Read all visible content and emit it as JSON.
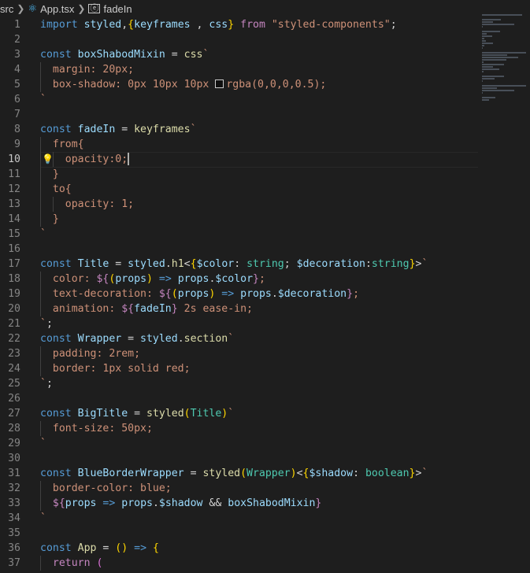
{
  "breadcrumb": {
    "folder": "src",
    "file": "App.tsx",
    "symbol": "fadeIn"
  },
  "editor": {
    "current_line": 10,
    "lines": [
      {
        "n": "1",
        "parts": [
          [
            "kw",
            "import "
          ],
          [
            "v",
            "styled"
          ],
          [
            "",
            ","
          ],
          [
            "br1",
            "{"
          ],
          [
            "v",
            "keyframes"
          ],
          [
            "",
            " ,"
          ],
          [
            "v",
            " css"
          ],
          [
            "br1",
            "}"
          ],
          [
            "ctl",
            " from "
          ],
          [
            "str",
            "\"styled-components\""
          ],
          [
            "",
            ";"
          ]
        ]
      },
      {
        "n": "2",
        "parts": []
      },
      {
        "n": "3",
        "parts": [
          [
            "kw",
            "const "
          ],
          [
            "v",
            "boxShabodMixin"
          ],
          [
            "",
            " = "
          ],
          [
            "fn",
            "css"
          ],
          [
            "str",
            "`"
          ]
        ]
      },
      {
        "n": "4",
        "indent": 1,
        "parts": [
          [
            "str",
            "  margin: 20px;"
          ]
        ]
      },
      {
        "n": "5",
        "indent": 1,
        "parts": [
          [
            "str",
            "  box-shadow: 0px 10px 10px "
          ],
          [
            "swatch",
            ""
          ],
          [
            "str",
            "rgba(0,0,0,0.5);"
          ]
        ]
      },
      {
        "n": "6",
        "parts": [
          [
            "str",
            "`"
          ]
        ]
      },
      {
        "n": "7",
        "parts": []
      },
      {
        "n": "8",
        "parts": [
          [
            "kw",
            "const "
          ],
          [
            "v",
            "fadeIn"
          ],
          [
            "",
            " = "
          ],
          [
            "fn",
            "keyframes"
          ],
          [
            "str",
            "`"
          ]
        ]
      },
      {
        "n": "9",
        "indent": 1,
        "parts": [
          [
            "str",
            "  from{"
          ]
        ]
      },
      {
        "n": "10",
        "indent": 2,
        "bulb": true,
        "cursor": true,
        "parts": [
          [
            "str",
            "    opacity:0;"
          ]
        ]
      },
      {
        "n": "11",
        "indent": 1,
        "parts": [
          [
            "str",
            "  }"
          ]
        ]
      },
      {
        "n": "12",
        "indent": 1,
        "parts": [
          [
            "str",
            "  to{"
          ]
        ]
      },
      {
        "n": "13",
        "indent": 2,
        "parts": [
          [
            "str",
            "    opacity: 1;"
          ]
        ]
      },
      {
        "n": "14",
        "indent": 1,
        "parts": [
          [
            "str",
            "  }"
          ]
        ]
      },
      {
        "n": "15",
        "parts": [
          [
            "str",
            "`"
          ]
        ]
      },
      {
        "n": "16",
        "parts": []
      },
      {
        "n": "17",
        "parts": [
          [
            "kw",
            "const "
          ],
          [
            "v",
            "Title"
          ],
          [
            "",
            " = "
          ],
          [
            "v",
            "styled"
          ],
          [
            "",
            "."
          ],
          [
            "fn",
            "h1"
          ],
          [
            "",
            "<"
          ],
          [
            "br1",
            "{"
          ],
          [
            "v",
            "$color"
          ],
          [
            "",
            ": "
          ],
          [
            "ty",
            "string"
          ],
          [
            "",
            "; "
          ],
          [
            "v",
            "$decoration"
          ],
          [
            "",
            ":"
          ],
          [
            "ty",
            "string"
          ],
          [
            "br1",
            "}"
          ],
          [
            "",
            ">"
          ],
          [
            "str",
            "`"
          ]
        ]
      },
      {
        "n": "18",
        "indent": 1,
        "parts": [
          [
            "str",
            "  color: "
          ],
          [
            "ctl",
            "${"
          ],
          [
            "br1",
            "("
          ],
          [
            "v",
            "props"
          ],
          [
            "br1",
            ")"
          ],
          [
            "kw",
            " =>"
          ],
          [
            "v",
            " props"
          ],
          [
            "",
            "."
          ],
          [
            "v",
            "$color"
          ],
          [
            "ctl",
            "}"
          ],
          [
            "str",
            ";"
          ]
        ]
      },
      {
        "n": "19",
        "indent": 1,
        "parts": [
          [
            "str",
            "  text-decoration: "
          ],
          [
            "ctl",
            "${"
          ],
          [
            "br1",
            "("
          ],
          [
            "v",
            "props"
          ],
          [
            "br1",
            ")"
          ],
          [
            "kw",
            " =>"
          ],
          [
            "v",
            " props"
          ],
          [
            "",
            "."
          ],
          [
            "v",
            "$decoration"
          ],
          [
            "ctl",
            "}"
          ],
          [
            "str",
            ";"
          ]
        ]
      },
      {
        "n": "20",
        "indent": 1,
        "parts": [
          [
            "str",
            "  animation: "
          ],
          [
            "ctl",
            "${"
          ],
          [
            "v",
            "fadeIn"
          ],
          [
            "ctl",
            "}"
          ],
          [
            "str",
            " 2s ease-in;"
          ]
        ]
      },
      {
        "n": "21",
        "parts": [
          [
            "str",
            "`"
          ],
          [
            "",
            ";"
          ]
        ]
      },
      {
        "n": "22",
        "parts": [
          [
            "kw",
            "const "
          ],
          [
            "v",
            "Wrapper"
          ],
          [
            "",
            " = "
          ],
          [
            "v",
            "styled"
          ],
          [
            "",
            "."
          ],
          [
            "fn",
            "section"
          ],
          [
            "str",
            "`"
          ]
        ]
      },
      {
        "n": "23",
        "indent": 1,
        "parts": [
          [
            "str",
            "  padding: 2rem;"
          ]
        ]
      },
      {
        "n": "24",
        "indent": 1,
        "parts": [
          [
            "str",
            "  border: 1px solid red;"
          ]
        ]
      },
      {
        "n": "25",
        "parts": [
          [
            "str",
            "`"
          ],
          [
            "",
            ";"
          ]
        ]
      },
      {
        "n": "26",
        "parts": []
      },
      {
        "n": "27",
        "parts": [
          [
            "kw",
            "const "
          ],
          [
            "v",
            "BigTitle"
          ],
          [
            "",
            " = "
          ],
          [
            "fn",
            "styled"
          ],
          [
            "br1",
            "("
          ],
          [
            "ty",
            "Title"
          ],
          [
            "br1",
            ")"
          ],
          [
            "str",
            "`"
          ]
        ]
      },
      {
        "n": "28",
        "indent": 1,
        "parts": [
          [
            "str",
            "  font-size: 50px;"
          ]
        ]
      },
      {
        "n": "29",
        "parts": [
          [
            "str",
            "`"
          ]
        ]
      },
      {
        "n": "30",
        "parts": []
      },
      {
        "n": "31",
        "parts": [
          [
            "kw",
            "const "
          ],
          [
            "v",
            "BlueBorderWrapper"
          ],
          [
            "",
            " = "
          ],
          [
            "fn",
            "styled"
          ],
          [
            "br1",
            "("
          ],
          [
            "ty",
            "Wrapper"
          ],
          [
            "br1",
            ")"
          ],
          [
            "",
            "<"
          ],
          [
            "br1",
            "{"
          ],
          [
            "v",
            "$shadow"
          ],
          [
            "",
            ": "
          ],
          [
            "ty",
            "boolean"
          ],
          [
            "br1",
            "}"
          ],
          [
            "",
            ">"
          ],
          [
            "str",
            "`"
          ]
        ]
      },
      {
        "n": "32",
        "indent": 1,
        "parts": [
          [
            "str",
            "  border-color: blue;"
          ]
        ]
      },
      {
        "n": "33",
        "indent": 1,
        "parts": [
          [
            "str",
            "  "
          ],
          [
            "ctl",
            "${"
          ],
          [
            "v",
            "props"
          ],
          [
            "kw",
            " =>"
          ],
          [
            "v",
            " props"
          ],
          [
            "",
            "."
          ],
          [
            "v",
            "$shadow"
          ],
          [
            "",
            " && "
          ],
          [
            "v",
            "boxShabodMixin"
          ],
          [
            "ctl",
            "}"
          ]
        ]
      },
      {
        "n": "34",
        "parts": [
          [
            "str",
            "`"
          ]
        ]
      },
      {
        "n": "35",
        "parts": []
      },
      {
        "n": "36",
        "parts": [
          [
            "kw",
            "const "
          ],
          [
            "fn",
            "App"
          ],
          [
            "",
            " = "
          ],
          [
            "br1",
            "()"
          ],
          [
            "kw",
            " => "
          ],
          [
            "br1",
            "{"
          ]
        ]
      },
      {
        "n": "37",
        "indent": 1,
        "parts": [
          [
            "ctl",
            "  return "
          ],
          [
            "br2",
            "("
          ]
        ]
      }
    ]
  }
}
